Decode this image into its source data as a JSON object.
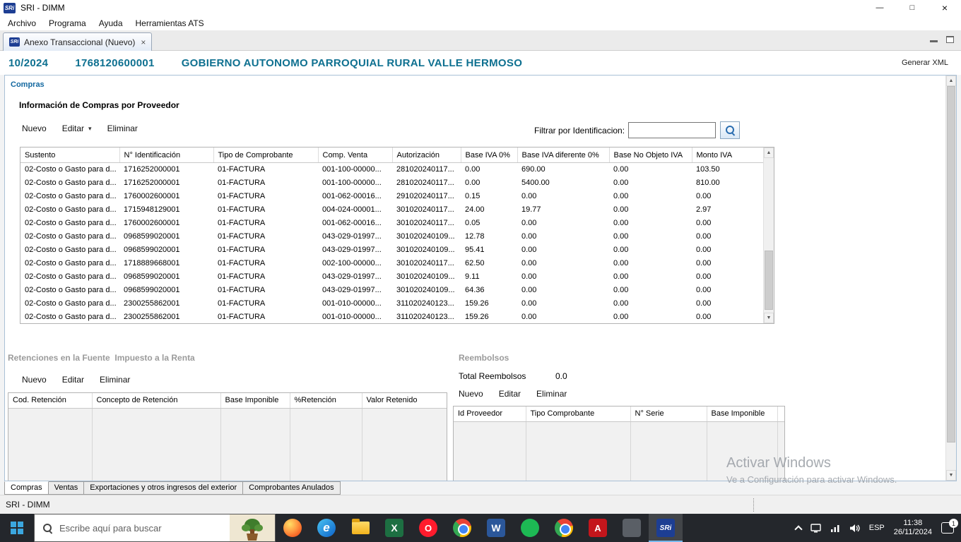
{
  "logo": {
    "small": "SRi"
  },
  "window": {
    "title": "SRI - DIMM",
    "menu_items": [
      "Archivo",
      "Programa",
      "Ayuda",
      "Herramientas ATS"
    ]
  },
  "editor_tab": {
    "label": "Anexo Transaccional (Nuevo)"
  },
  "header": {
    "period": "10/2024",
    "ruc": "1768120600001",
    "entity": "GOBIERNO AUTONOMO PARROQUIAL RURAL VALLE HERMOSO",
    "generate_xml": "Generar XML"
  },
  "icons": {
    "minimize": "—",
    "maximize": "□",
    "close": "×",
    "dropdown": "▾",
    "scroll_up": "▲",
    "scroll_down": "▼"
  },
  "compras": {
    "section_label": "Compras",
    "title": "Información de Compras por Proveedor",
    "toolbar": {
      "nuevo": "Nuevo",
      "editar": "Editar",
      "eliminar": "Eliminar"
    },
    "filter_label": "Filtrar por Identificacion:",
    "filter_value": "",
    "columns": [
      "Sustento",
      "N° Identificación",
      "Tipo de Comprobante",
      "Comp. Venta",
      "Autorización",
      "Base IVA 0%",
      "Base IVA diferente 0%",
      "Base No Objeto IVA",
      "Monto IVA"
    ],
    "rows": [
      [
        "02-Costo o Gasto para d...",
        "1716252000001",
        "01-FACTURA",
        "001-100-00000...",
        "281020240117...",
        "0.00",
        "690.00",
        "0.00",
        "103.50"
      ],
      [
        "02-Costo o Gasto para d...",
        "1716252000001",
        "01-FACTURA",
        "001-100-00000...",
        "281020240117...",
        "0.00",
        "5400.00",
        "0.00",
        "810.00"
      ],
      [
        "02-Costo o Gasto para d...",
        "1760002600001",
        "01-FACTURA",
        "001-062-00016...",
        "291020240117...",
        "0.15",
        "0.00",
        "0.00",
        "0.00"
      ],
      [
        "02-Costo o Gasto para d...",
        "1715948129001",
        "01-FACTURA",
        "004-024-00001...",
        "301020240117...",
        "24.00",
        "19.77",
        "0.00",
        "2.97"
      ],
      [
        "02-Costo o Gasto para d...",
        "1760002600001",
        "01-FACTURA",
        "001-062-00016...",
        "301020240117...",
        "0.05",
        "0.00",
        "0.00",
        "0.00"
      ],
      [
        "02-Costo o Gasto para d...",
        "0968599020001",
        "01-FACTURA",
        "043-029-01997...",
        "301020240109...",
        "12.78",
        "0.00",
        "0.00",
        "0.00"
      ],
      [
        "02-Costo o Gasto para d...",
        "0968599020001",
        "01-FACTURA",
        "043-029-01997...",
        "301020240109...",
        "95.41",
        "0.00",
        "0.00",
        "0.00"
      ],
      [
        "02-Costo o Gasto para d...",
        "1718889668001",
        "01-FACTURA",
        "002-100-00000...",
        "301020240117...",
        "62.50",
        "0.00",
        "0.00",
        "0.00"
      ],
      [
        "02-Costo o Gasto para d...",
        "0968599020001",
        "01-FACTURA",
        "043-029-01997...",
        "301020240109...",
        "9.11",
        "0.00",
        "0.00",
        "0.00"
      ],
      [
        "02-Costo o Gasto para d...",
        "0968599020001",
        "01-FACTURA",
        "043-029-01997...",
        "301020240109...",
        "64.36",
        "0.00",
        "0.00",
        "0.00"
      ],
      [
        "02-Costo o Gasto para d...",
        "2300255862001",
        "01-FACTURA",
        "001-010-00000...",
        "311020240123...",
        "159.26",
        "0.00",
        "0.00",
        "0.00"
      ],
      [
        "02-Costo o Gasto para d...",
        "2300255862001",
        "01-FACTURA",
        "001-010-00000...",
        "311020240123...",
        "159.26",
        "0.00",
        "0.00",
        "0.00"
      ]
    ]
  },
  "retenciones": {
    "title": "Retenciones en la Fuente  Impuesto a la Renta",
    "toolbar": {
      "nuevo": "Nuevo",
      "editar": "Editar",
      "eliminar": "Eliminar"
    },
    "columns": [
      "Cod. Retención",
      "Concepto de Retención",
      "Base Imponible",
      "%Retención",
      "Valor Retenido"
    ]
  },
  "reembolsos": {
    "title": "Reembolsos",
    "total_label": "Total Reembolsos",
    "total_value": "0.0",
    "toolbar": {
      "nuevo": "Nuevo",
      "editar": "Editar",
      "eliminar": "Eliminar"
    },
    "columns": [
      "Id Proveedor",
      "Tipo Comprobante",
      "N° Serie",
      "Base Imponible"
    ]
  },
  "bottom_tabs": [
    "Compras",
    "Ventas",
    "Exportaciones y otros ingresos del exterior",
    "Comprobantes Anulados"
  ],
  "status_bar": {
    "text": "SRI - DIMM"
  },
  "watermark": {
    "line1": "Activar Windows",
    "line2": "Ve a Configuración para activar Windows."
  },
  "taskbar": {
    "search_placeholder": "Escribe aquí para buscar",
    "language": "ESP",
    "time": "11:38",
    "date": "26/11/2024",
    "notification_count": "1",
    "apps": [
      {
        "name": "firefox",
        "class": "firefox",
        "glyph": ""
      },
      {
        "name": "edge",
        "class": "edge",
        "glyph": "e"
      },
      {
        "name": "file-explorer",
        "class": "explorer",
        "glyph": ""
      },
      {
        "name": "excel",
        "class": "excel",
        "glyph": "X"
      },
      {
        "name": "opera",
        "class": "opera",
        "glyph": "O"
      },
      {
        "name": "chrome",
        "class": "chrome",
        "glyph": ""
      },
      {
        "name": "word",
        "class": "word",
        "glyph": "W"
      },
      {
        "name": "spotify",
        "class": "spotify",
        "glyph": ""
      },
      {
        "name": "chrome-2",
        "class": "chrome",
        "glyph": ""
      },
      {
        "name": "acrobat",
        "class": "acrobat",
        "glyph": "A"
      },
      {
        "name": "generic-app",
        "class": "generic",
        "glyph": ""
      },
      {
        "name": "sri-dimm",
        "class": "sri",
        "glyph": "SRi",
        "active": true
      }
    ]
  },
  "colors": {
    "header_teal": "#0e7090",
    "section_blue": "#1368a0",
    "muted_title": "#9b9b9b",
    "panel_border": "#a9c0d6",
    "taskbar_bg": "#24272c",
    "active_app_highlight": "#76b9ed"
  }
}
